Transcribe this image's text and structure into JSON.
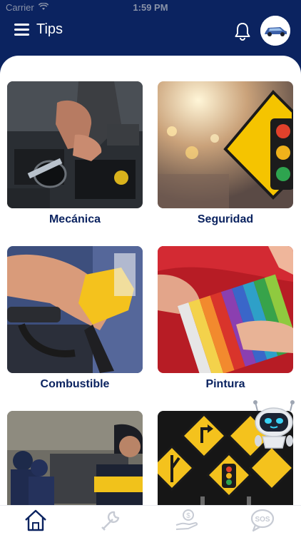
{
  "status_bar": {
    "carrier": "Carrier",
    "time": "1:59 PM"
  },
  "header": {
    "title": "Tips",
    "menu_icon": "hamburger-menu-icon",
    "bell_icon": "bell-icon",
    "avatar_icon": "car-avatar"
  },
  "tiles": [
    {
      "label": "Mecánica",
      "image": "engine-repair-photo"
    },
    {
      "label": "Seguridad",
      "image": "traffic-light-sign-photo"
    },
    {
      "label": "Combustible",
      "image": "fuel-nozzle-photo"
    },
    {
      "label": "Pintura",
      "image": "paint-color-swatches-photo"
    },
    {
      "label": "",
      "image": "traffic-police-photo"
    },
    {
      "label": "",
      "image": "road-signs-photo"
    }
  ],
  "bottom_nav": [
    {
      "icon": "home-icon",
      "active": true
    },
    {
      "icon": "wrench-icon",
      "active": false
    },
    {
      "icon": "money-hand-icon",
      "active": false
    },
    {
      "icon": "sos-chat-icon",
      "active": false
    }
  ],
  "assistant": {
    "icon": "robot-assistant-icon"
  },
  "colors": {
    "brand": "#0b2360",
    "inactive_icon": "#c7cbd4"
  }
}
